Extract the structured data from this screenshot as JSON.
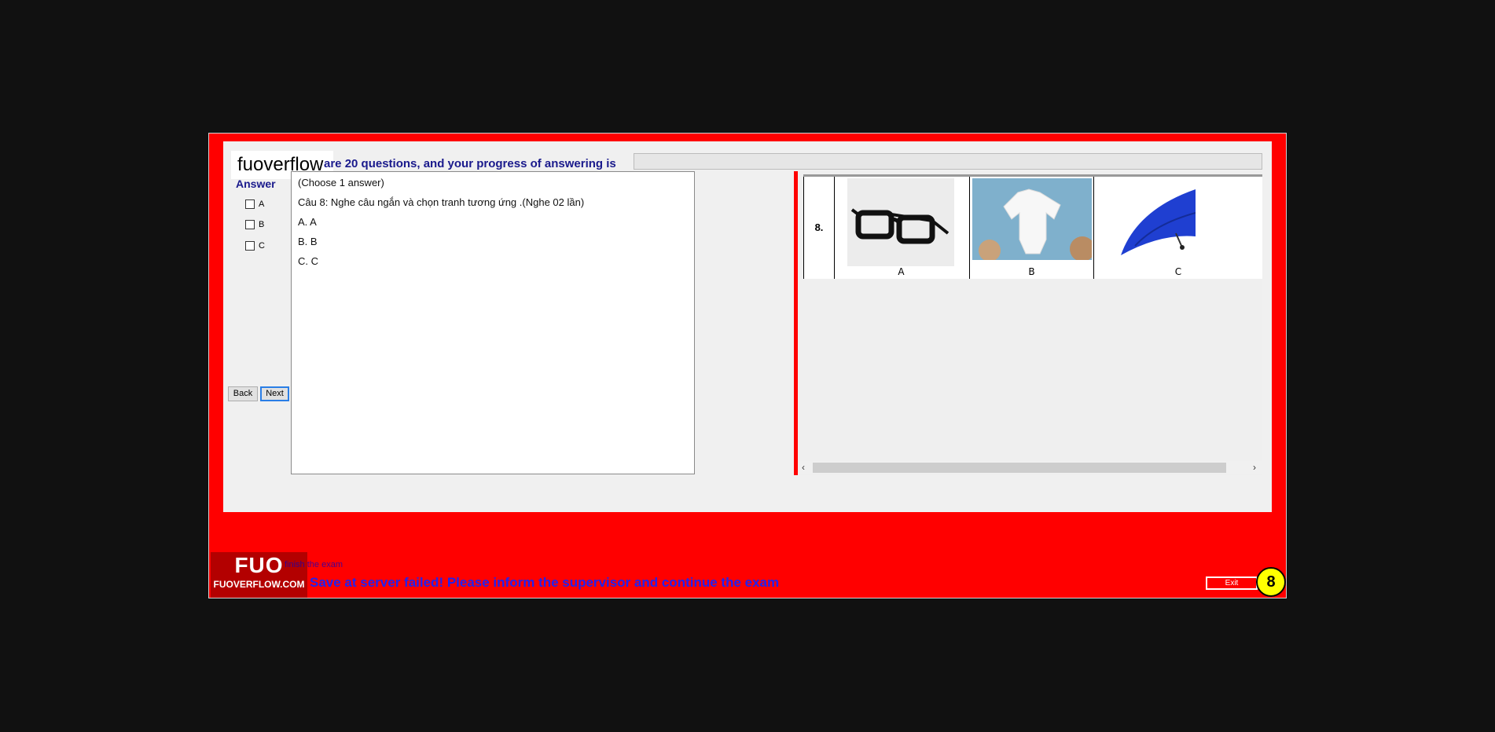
{
  "header": {
    "brand": "fuoverflow",
    "progress_text": "are 20 questions, and your progress of answering is",
    "progress_fraction": 0
  },
  "answer": {
    "title": "Answer",
    "options": [
      "A",
      "B",
      "C"
    ],
    "back_label": "Back",
    "next_label": "Next"
  },
  "question": {
    "instruction": "(Choose 1 answer)",
    "prompt": "Câu 8: Nghe câu ngắn và chọn tranh tương ứng .(Nghe 02 lần)",
    "choices": [
      "A.  A",
      "B.  B",
      "C.  C"
    ]
  },
  "image_table": {
    "number": "8.",
    "captions": [
      "A",
      "B",
      "C"
    ],
    "items": [
      "glasses-image",
      "baby-onesie-image",
      "umbrella-image"
    ]
  },
  "footer": {
    "logo_text": "FUO",
    "logo_url": "FUOVERFLOW.COM",
    "finish_text": "finish the exam",
    "status_message": "Save at server failed!  Please inform the supervisor and continue the exam",
    "exit_label": "Exit",
    "question_number": "8"
  },
  "colors": {
    "window_bg": "#ff0000",
    "header_text": "#1a1a8c",
    "status_text": "#2222ee",
    "badge": "#ffff00"
  }
}
